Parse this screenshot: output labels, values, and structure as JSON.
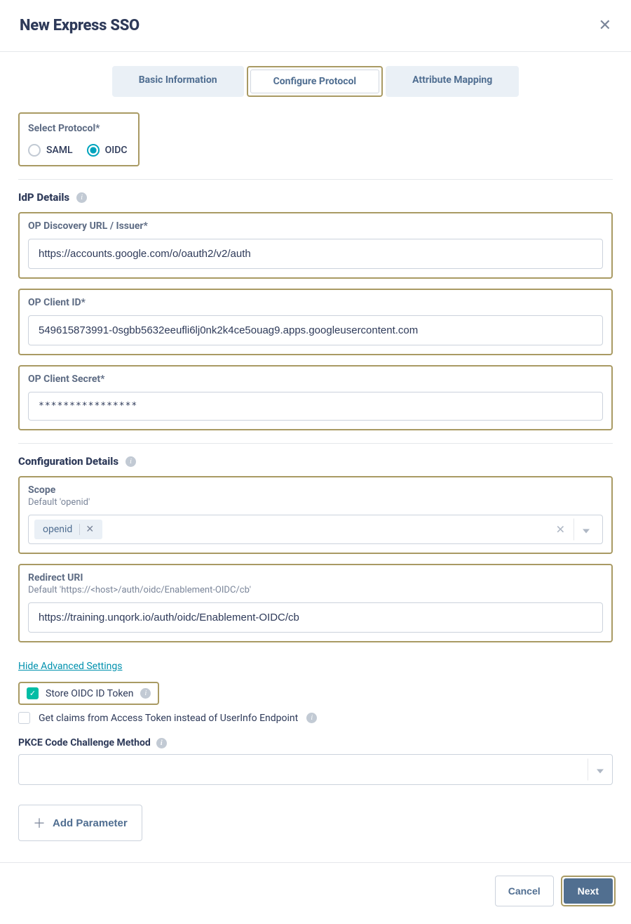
{
  "header": {
    "title": "New Express SSO"
  },
  "tabs": {
    "basic": "Basic Information",
    "configure": "Configure Protocol",
    "attribute": "Attribute Mapping"
  },
  "protocol": {
    "label": "Select Protocol*",
    "options": {
      "saml": "SAML",
      "oidc": "OIDC"
    },
    "selected": "oidc"
  },
  "idp": {
    "heading": "IdP Details",
    "discovery": {
      "label": "OP Discovery URL / Issuer*",
      "value": "https://accounts.google.com/o/oauth2/v2/auth"
    },
    "client_id": {
      "label": "OP Client ID*",
      "value": "549615873991-0sgbb5632eeufli6lj0nk2k4ce5ouag9.apps.googleusercontent.com"
    },
    "client_secret": {
      "label": "OP Client Secret*",
      "value": "****************"
    }
  },
  "config": {
    "heading": "Configuration Details",
    "scope": {
      "label": "Scope",
      "subtext": "Default 'openid'",
      "tag": "openid"
    },
    "redirect": {
      "label": "Redirect URI",
      "subtext": "Default 'https://<host>/auth/oidc/Enablement-OIDC/cb'",
      "value": "https://training.unqork.io/auth/oidc/Enablement-OIDC/cb"
    },
    "hide_link": "Hide Advanced Settings",
    "store_token": {
      "label": "Store OIDC ID Token",
      "checked": true
    },
    "claims_access": {
      "label": "Get claims from Access Token instead of UserInfo Endpoint",
      "checked": false
    },
    "pkce": {
      "label": "PKCE Code Challenge Method",
      "value": ""
    },
    "add_param": "Add Parameter"
  },
  "footer": {
    "cancel": "Cancel",
    "next": "Next"
  }
}
